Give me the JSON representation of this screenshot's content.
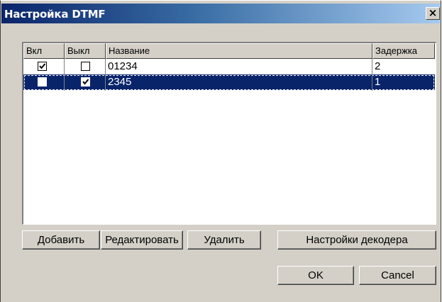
{
  "window": {
    "title": "Настройка DTMF",
    "close_glyph": "×"
  },
  "list": {
    "columns": [
      "Вкл",
      "Выкл",
      "Название",
      "Задержка"
    ],
    "rows": [
      {
        "on": true,
        "off": false,
        "name": "01234",
        "delay": "2",
        "selected": false
      },
      {
        "on": false,
        "off": true,
        "name": "2345",
        "delay": "1",
        "selected": true
      }
    ]
  },
  "buttons": {
    "add": "Добавить",
    "edit": "Редактировать",
    "delete": "Удалить",
    "decoder_settings": "Настройки декодера",
    "ok": "OK",
    "cancel": "Cancel"
  },
  "colors": {
    "selection": "#0a246a",
    "face": "#d4d0c8",
    "title_gradient_start": "#0a246a",
    "title_gradient_end": "#a6caf0"
  }
}
